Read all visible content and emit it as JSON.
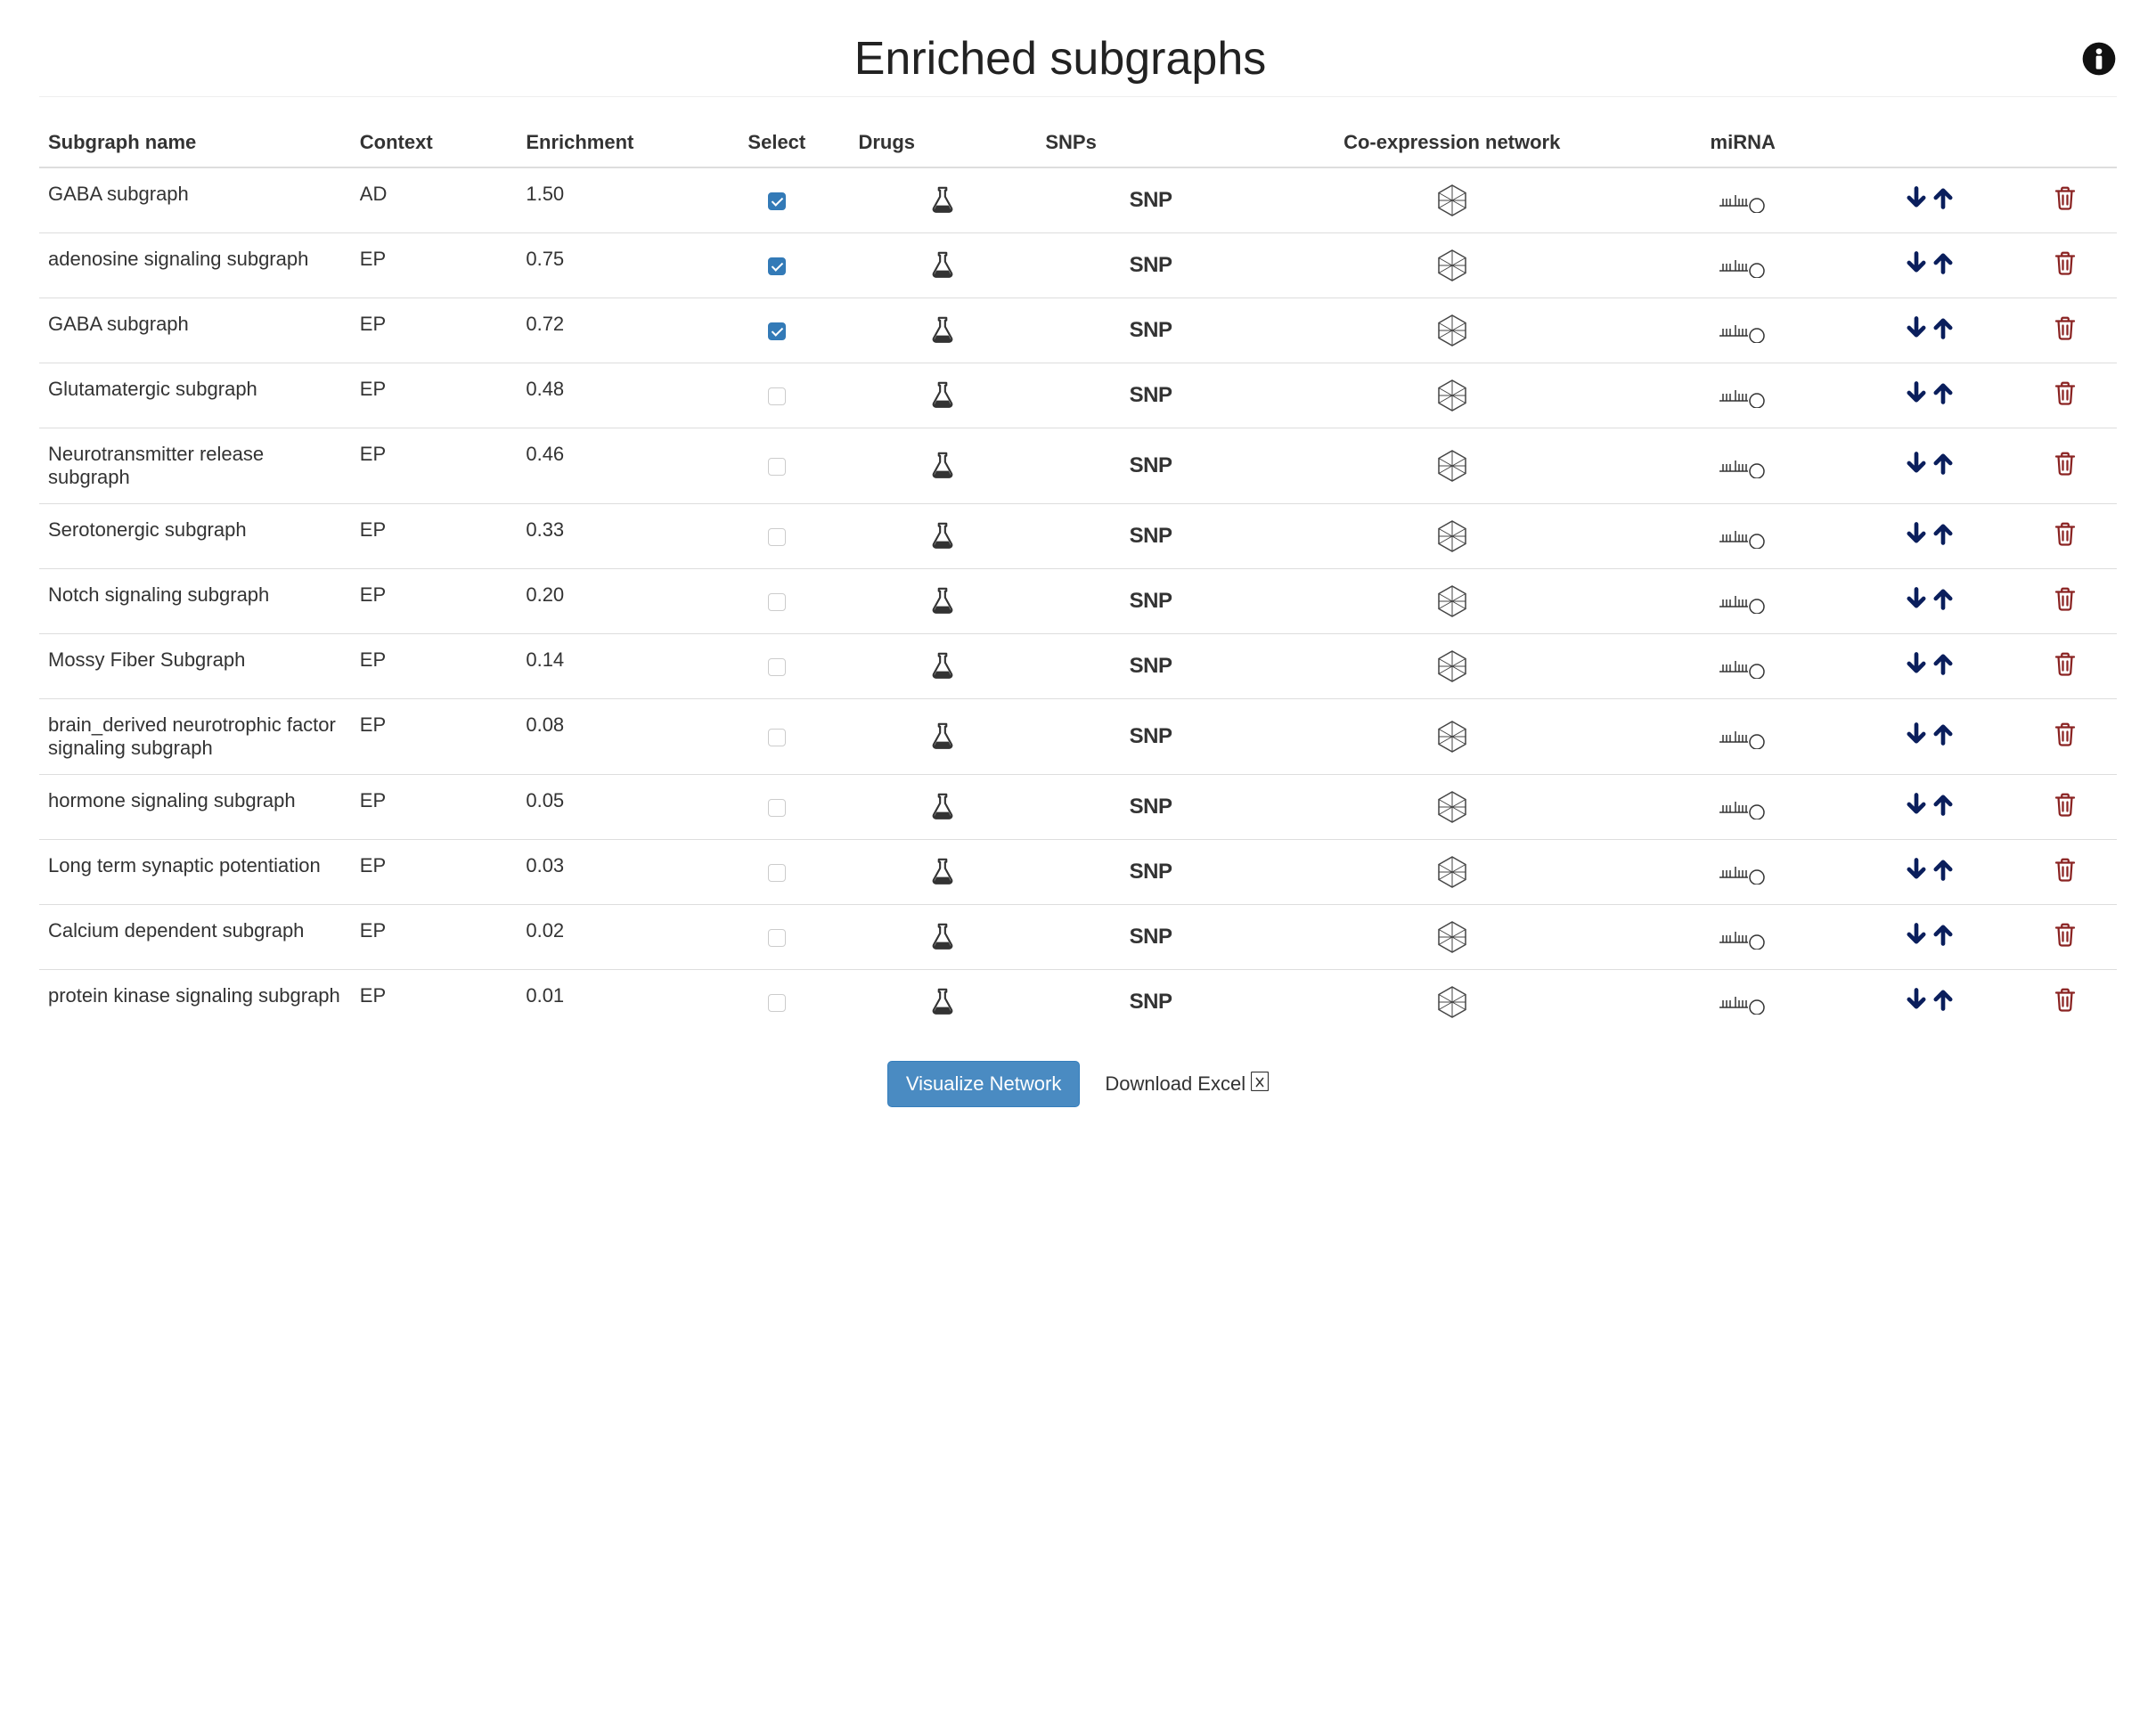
{
  "header": {
    "title": "Enriched subgraphs"
  },
  "columns": {
    "name": "Subgraph name",
    "context": "Context",
    "enrichment": "Enrichment",
    "select": "Select",
    "drugs": "Drugs",
    "snps": "SNPs",
    "coex": "Co-expression network",
    "mirna": "miRNA"
  },
  "snp_label": "SNP",
  "rows": [
    {
      "name": "GABA subgraph",
      "context": "AD",
      "enrichment": "1.50",
      "selected": true
    },
    {
      "name": "adenosine signaling subgraph",
      "context": "EP",
      "enrichment": "0.75",
      "selected": true
    },
    {
      "name": "GABA subgraph",
      "context": "EP",
      "enrichment": "0.72",
      "selected": true
    },
    {
      "name": "Glutamatergic subgraph",
      "context": "EP",
      "enrichment": "0.48",
      "selected": false
    },
    {
      "name": "Neurotransmitter release subgraph",
      "context": "EP",
      "enrichment": "0.46",
      "selected": false
    },
    {
      "name": "Serotonergic subgraph",
      "context": "EP",
      "enrichment": "0.33",
      "selected": false
    },
    {
      "name": "Notch signaling subgraph",
      "context": "EP",
      "enrichment": "0.20",
      "selected": false
    },
    {
      "name": "Mossy Fiber Subgraph",
      "context": "EP",
      "enrichment": "0.14",
      "selected": false
    },
    {
      "name": "brain_derived neurotrophic factor signaling subgraph",
      "context": "EP",
      "enrichment": "0.08",
      "selected": false
    },
    {
      "name": "hormone signaling subgraph",
      "context": "EP",
      "enrichment": "0.05",
      "selected": false
    },
    {
      "name": "Long term synaptic potentiation",
      "context": "EP",
      "enrichment": "0.03",
      "selected": false
    },
    {
      "name": "Calcium dependent subgraph",
      "context": "EP",
      "enrichment": "0.02",
      "selected": false
    },
    {
      "name": "protein kinase signaling subgraph",
      "context": "EP",
      "enrichment": "0.01",
      "selected": false
    }
  ],
  "footer": {
    "visualize_label": "Visualize Network",
    "download_label": "Download Excel"
  },
  "colors": {
    "arrow": "#0a1e5c",
    "trash": "#8a2322",
    "primary": "#4a8bc2"
  }
}
